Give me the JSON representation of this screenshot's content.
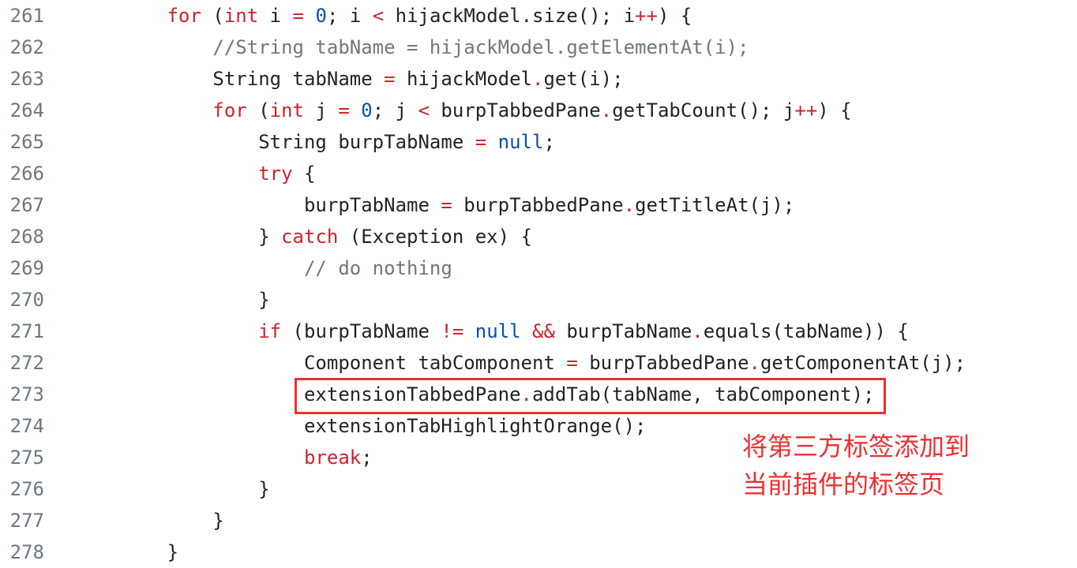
{
  "code": {
    "lines": [
      {
        "num": "261",
        "tokens": [
          [
            "p",
            "        "
          ],
          [
            "k",
            "for"
          ],
          [
            "p",
            " ("
          ],
          [
            "k",
            "int"
          ],
          [
            "p",
            " i "
          ],
          [
            "k",
            "="
          ],
          [
            "p",
            " "
          ],
          [
            "c",
            "0"
          ],
          [
            "p",
            "; i "
          ],
          [
            "k",
            "<"
          ],
          [
            "p",
            " hijackModel.size(); i"
          ],
          [
            "k",
            "++"
          ],
          [
            "p",
            ") {"
          ]
        ]
      },
      {
        "num": "262",
        "tokens": [
          [
            "p",
            "            "
          ],
          [
            "cm",
            "//String tabName = hijackModel.getElementAt(i);"
          ]
        ]
      },
      {
        "num": "263",
        "tokens": [
          [
            "p",
            "            String tabName "
          ],
          [
            "k",
            "="
          ],
          [
            "p",
            " hijackModel"
          ],
          [
            "k",
            "."
          ],
          [
            "p",
            "get(i);"
          ]
        ]
      },
      {
        "num": "264",
        "tokens": [
          [
            "p",
            "            "
          ],
          [
            "k",
            "for"
          ],
          [
            "p",
            " ("
          ],
          [
            "k",
            "int"
          ],
          [
            "p",
            " j "
          ],
          [
            "k",
            "="
          ],
          [
            "p",
            " "
          ],
          [
            "c",
            "0"
          ],
          [
            "p",
            "; j "
          ],
          [
            "k",
            "<"
          ],
          [
            "p",
            " burpTabbedPane"
          ],
          [
            "k",
            "."
          ],
          [
            "p",
            "getTabCount(); j"
          ],
          [
            "k",
            "++"
          ],
          [
            "p",
            ") {"
          ]
        ]
      },
      {
        "num": "265",
        "tokens": [
          [
            "p",
            "                String burpTabName "
          ],
          [
            "k",
            "="
          ],
          [
            "p",
            " "
          ],
          [
            "c",
            "null"
          ],
          [
            "p",
            ";"
          ]
        ]
      },
      {
        "num": "266",
        "tokens": [
          [
            "p",
            "                "
          ],
          [
            "k",
            "try"
          ],
          [
            "p",
            " {"
          ]
        ]
      },
      {
        "num": "267",
        "tokens": [
          [
            "p",
            "                    burpTabName "
          ],
          [
            "k",
            "="
          ],
          [
            "p",
            " burpTabbedPane"
          ],
          [
            "k",
            "."
          ],
          [
            "p",
            "getTitleAt(j);"
          ]
        ]
      },
      {
        "num": "268",
        "tokens": [
          [
            "p",
            "                } "
          ],
          [
            "k",
            "catch"
          ],
          [
            "p",
            " (Exception ex) {"
          ]
        ]
      },
      {
        "num": "269",
        "tokens": [
          [
            "p",
            "                    "
          ],
          [
            "cm",
            "// do nothing"
          ]
        ]
      },
      {
        "num": "270",
        "tokens": [
          [
            "p",
            "                }"
          ]
        ]
      },
      {
        "num": "271",
        "tokens": [
          [
            "p",
            "                "
          ],
          [
            "k",
            "if"
          ],
          [
            "p",
            " (burpTabName "
          ],
          [
            "k",
            "!="
          ],
          [
            "p",
            " "
          ],
          [
            "c",
            "null"
          ],
          [
            "p",
            " "
          ],
          [
            "k",
            "&&"
          ],
          [
            "p",
            " burpTabName"
          ],
          [
            "k",
            "."
          ],
          [
            "p",
            "equals(tabName)) {"
          ]
        ]
      },
      {
        "num": "272",
        "tokens": [
          [
            "p",
            "                    Component tabComponent "
          ],
          [
            "k",
            "="
          ],
          [
            "p",
            " burpTabbedPane"
          ],
          [
            "k",
            "."
          ],
          [
            "p",
            "getComponentAt(j);"
          ]
        ]
      },
      {
        "num": "273",
        "tokens": [
          [
            "p",
            "                    extensionTabbedPane"
          ],
          [
            "k",
            "."
          ],
          [
            "p",
            "addTab(tabName, tabComponent);"
          ]
        ]
      },
      {
        "num": "274",
        "tokens": [
          [
            "p",
            "                    extensionTabHighlightOrange();"
          ]
        ]
      },
      {
        "num": "275",
        "tokens": [
          [
            "p",
            "                    "
          ],
          [
            "k",
            "break"
          ],
          [
            "p",
            ";"
          ]
        ]
      },
      {
        "num": "276",
        "tokens": [
          [
            "p",
            "                }"
          ]
        ]
      },
      {
        "num": "277",
        "tokens": [
          [
            "p",
            "            }"
          ]
        ]
      },
      {
        "num": "278",
        "tokens": [
          [
            "p",
            "        }"
          ]
        ]
      }
    ]
  },
  "annotation": {
    "line1": "将第三方标签添加到",
    "line2": "当前插件的标签页",
    "color": "#ee3030"
  }
}
